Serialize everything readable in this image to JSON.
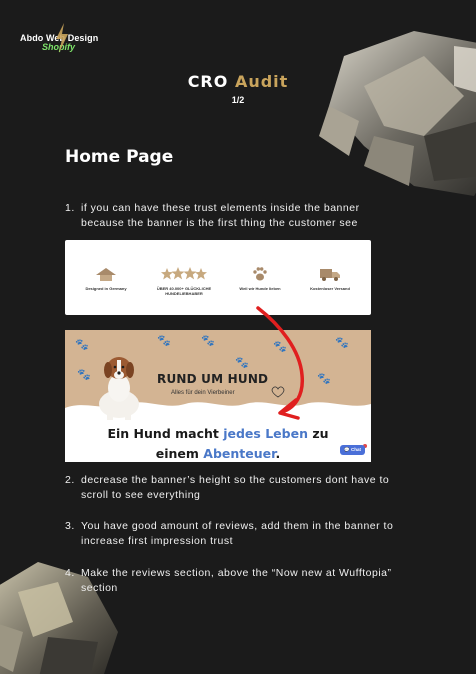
{
  "logo": {
    "line1": "Abdo Web Design",
    "line2": "Shopify"
  },
  "header": {
    "title_main": "CRO",
    "title_accent": "Audit",
    "page_indicator": "1/2"
  },
  "section": {
    "heading": "Home Page"
  },
  "points": [
    {
      "number": "1.",
      "text": "if you can have these trust elements inside the banner because the banner is the first thing the customer see"
    },
    {
      "number": "2.",
      "text": "decrease the banner’s height so the customers dont have to scroll to see everything"
    },
    {
      "number": "3.",
      "text": "You have good amount of reviews, add them in the banner to increase first impression trust"
    },
    {
      "number": "4.",
      "text": "Make the reviews section, above the “Now new at Wufftopia” section"
    }
  ],
  "trust_strip": {
    "items": [
      {
        "label": "Designed in Germany",
        "icon": "germany-house-icon"
      },
      {
        "label": "ÜBER 40.000+ GLÜCKLICHE HUNDELIEBHABER",
        "icon": "stars-icon"
      },
      {
        "label": "Weil wir Hunde lieben",
        "icon": "paw-icon"
      },
      {
        "label": "Kostenloser Versand",
        "icon": "truck-icon"
      }
    ]
  },
  "banner": {
    "brand": "RUND UM HUND",
    "tagline": "Alles für dein Vierbeiner",
    "headline": {
      "part1": "Ein Hund macht ",
      "highlight1": "jedes Leben",
      "part2": " zu",
      "part3": "einem ",
      "highlight2": "Abenteuer",
      "part4": "."
    },
    "chat_label": "Chat"
  },
  "colors": {
    "background": "#1b1b1b",
    "accent_gold": "#c9a45c",
    "logo_green": "#7ee36a",
    "banner_tan": "#d3b493",
    "highlight_blue": "#4a78c8",
    "annotation_red": "#e01f1f"
  }
}
